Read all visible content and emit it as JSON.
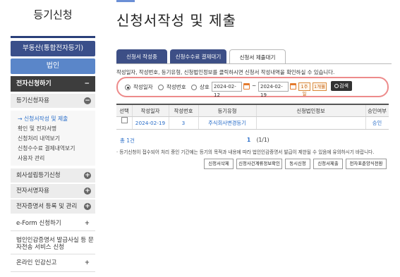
{
  "sidebar": {
    "title": "등기신청",
    "category_button": "부동산(통합전자등기)",
    "corp_button": "법인",
    "open_menu": {
      "label": "전자신청하기",
      "toggle": "−"
    },
    "sub_head": {
      "label": "등기신청자용",
      "toggle": "−"
    },
    "sub_items": [
      {
        "label": "→ 신청서작성 및 제출",
        "active": true
      },
      {
        "label": "확인 및 전자서명"
      },
      {
        "label": "신청처리 내역보기"
      },
      {
        "label": "신청수수료 결제내역보기"
      },
      {
        "label": "사용자 관리"
      }
    ],
    "rows": [
      {
        "label": "회사설립등기신청",
        "toggle": "+"
      },
      {
        "label": "전자서명자용",
        "toggle": "+"
      },
      {
        "label": "전자증명서 등록 및 관리",
        "toggle": "+"
      }
    ],
    "rows2": [
      {
        "label": "e-Form 신청하기",
        "toggle": "+"
      },
      {
        "label": "법인인감증명서 발급사실 등 문자전송 서비스 신청",
        "toggle": ""
      },
      {
        "label": "온라인 인감신고",
        "toggle": "+"
      }
    ]
  },
  "main": {
    "page_title": "신청서작성 및 제출",
    "tabs": [
      {
        "label": "신청서 작성중"
      },
      {
        "label": "신청수수료 결제대기"
      },
      {
        "label": "신청서 제출대기"
      }
    ],
    "description": "작성일자, 작성번호, 등기유형, 신청법인정보를 클릭하시면 신청서 작성내역을 확인하실 수 있습니다.",
    "search": {
      "radio_options": [
        "작성일자",
        "작성번호",
        "상호"
      ],
      "selected_index": 0,
      "date_from": "2024-02-12",
      "tilde": "~",
      "date_to": "2024-02-19",
      "period_buttons": [
        "1주일",
        "1개월"
      ],
      "search_button": "검색"
    },
    "table": {
      "headers": [
        "선택",
        "작성일자",
        "작성번호",
        "등기유형",
        "신청법인정보",
        "승인여부"
      ],
      "rows": [
        {
          "date": "2024-02-19",
          "number": "3",
          "type": "주식회사변경등기",
          "corp_info": "",
          "approval": "승인"
        }
      ]
    },
    "total": "총 1건",
    "pager": {
      "current": "1",
      "summary": "(1/1)"
    },
    "notice": "· 등기신청이 접수되어 처리 중인 기간에는 등기의 목적과 내용에 따라 법인인감증명서 발급이 제한될 수 있음에 유의하시기 바랍니다.",
    "action_buttons": [
      "신청서삭제",
      "신청사건계류정보확인",
      "동시신청",
      "신청서제출",
      "전자표준양식전환"
    ]
  }
}
